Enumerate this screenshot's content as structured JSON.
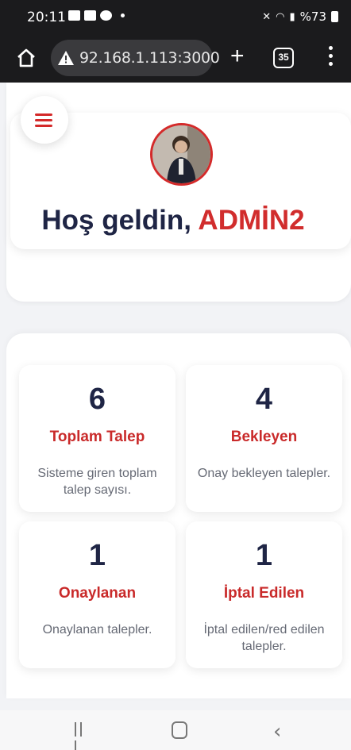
{
  "status_bar": {
    "time": "20:11",
    "battery_text": "%73"
  },
  "browser": {
    "url": "92.168.1.113:3000",
    "tab_count": "35"
  },
  "header": {
    "greeting": "Hoş geldin, ",
    "user_name": "ADMİN2"
  },
  "stats": [
    {
      "value": "6",
      "title": "Toplam Talep",
      "desc": "Sisteme giren toplam talep sayısı."
    },
    {
      "value": "4",
      "title": "Bekleyen",
      "desc": "Onay bekleyen talepler."
    },
    {
      "value": "1",
      "title": "Onaylanan",
      "desc": "Onaylanan talepler."
    },
    {
      "value": "1",
      "title": "İptal Edilen",
      "desc": "İptal edilen/red edilen talepler."
    }
  ],
  "colors": {
    "accent": "#d12d2d",
    "heading": "#1f2545",
    "dark_bar": "#1b1b1d"
  },
  "icons": [
    "home-icon",
    "warning-icon",
    "new-tab-icon",
    "tabs-icon",
    "menu-dots-icon",
    "hamburger-icon",
    "nav-recent-icon",
    "nav-home-icon",
    "nav-back-icon"
  ]
}
